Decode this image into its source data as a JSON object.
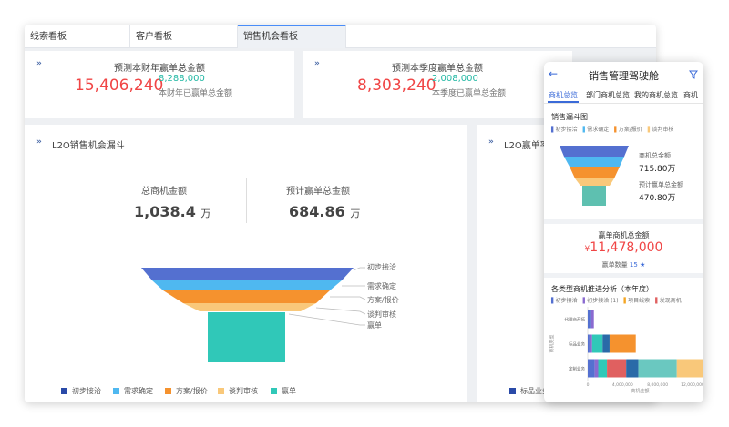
{
  "tabs": [
    {
      "label": "线索看板"
    },
    {
      "label": "客户看板"
    },
    {
      "label": "销售机会看板"
    }
  ],
  "kpi": [
    {
      "title": "预测本财年赢单总金额",
      "value": "15,406,240",
      "secondary": "8,288,000",
      "secondary_label": "本财年已赢单总金额"
    },
    {
      "title": "预测本季度赢单总金额",
      "value": "8,303,240",
      "secondary": "2,008,000",
      "secondary_label": "本季度已赢单总金额"
    }
  ],
  "funnel_card": {
    "title": "L2O销售机会漏斗",
    "total_label": "总商机金额",
    "total_value": "1,038.4",
    "total_unit": "万",
    "forecast_label": "预计赢单总金额",
    "forecast_value": "684.86",
    "forecast_unit": "万",
    "stages": [
      "初步接洽",
      "需求确定",
      "方案/报价",
      "谈判审核",
      "赢单"
    ],
    "colors": [
      "#5470d0",
      "#4fb8f0",
      "#f5922e",
      "#f9c87a",
      "#30c8b8"
    ]
  },
  "second_card": {
    "title": "L2O赢单率",
    "legend_partial": "标品业务"
  },
  "phone": {
    "back_icon": "arrow-left-icon",
    "title": "销售管理驾驶舱",
    "filter_icon": "filter-icon",
    "tabs": [
      "商机总览",
      "部门商机总览",
      "我的商机总览",
      "商机"
    ],
    "funnel": {
      "title": "销售漏斗图",
      "legend": [
        "初步接洽",
        "需求确定",
        "方案/报价",
        "谈判审核"
      ],
      "legend_colors": [
        "#5470d0",
        "#4fb8f0",
        "#f5922e",
        "#f9c87a"
      ],
      "amount_label": "商机总金额",
      "amount_value": "715.80万",
      "forecast_label": "预计赢单总金额",
      "forecast_value": "470.80万"
    },
    "won": {
      "label": "赢单商机总金额",
      "currency": "¥",
      "value": "11,478,000",
      "count_label": "赢单数量",
      "count_value": "15",
      "star": "★"
    },
    "bar": {
      "title": "各类型商机推进分析（本年度）",
      "legend": [
        "初步接洽",
        "初步接洽 (1)",
        "项目线索",
        "发现商机"
      ],
      "legend_colors": [
        "#5470d0",
        "#8a6ad0",
        "#f5a623",
        "#e06060"
      ],
      "ylabel": "商机类型",
      "xlabel": "商机金额"
    }
  },
  "chart_data": {
    "type": "bar",
    "orientation": "horizontal",
    "stacked": true,
    "title": "各类型商机推进分析（本年度）",
    "xlabel": "商机金额",
    "ylabel": "商机类型",
    "categories": [
      "代理商开拓",
      "标品业务",
      "定制业务"
    ],
    "x_ticks": [
      "0",
      "4,000,000",
      "8,000,000",
      "12,000,000"
    ],
    "xlim": [
      0,
      12000000
    ],
    "series": [
      {
        "color": "#5470d0",
        "values": [
          400000,
          200000,
          800000
        ]
      },
      {
        "color": "#8a6ad0",
        "values": [
          300000,
          300000,
          400000
        ]
      },
      {
        "color": "#30c8b8",
        "values": [
          0,
          1200000,
          1000000
        ]
      },
      {
        "color": "#e06060",
        "values": [
          0,
          0,
          2200000
        ]
      },
      {
        "color": "#2a6aa8",
        "values": [
          0,
          800000,
          1400000
        ]
      },
      {
        "color": "#f5922e",
        "values": [
          0,
          3000000,
          0
        ]
      },
      {
        "color": "#6ac8c0",
        "values": [
          0,
          0,
          4400000
        ]
      },
      {
        "color": "#f9c87a",
        "values": [
          0,
          0,
          3600000
        ]
      }
    ]
  }
}
